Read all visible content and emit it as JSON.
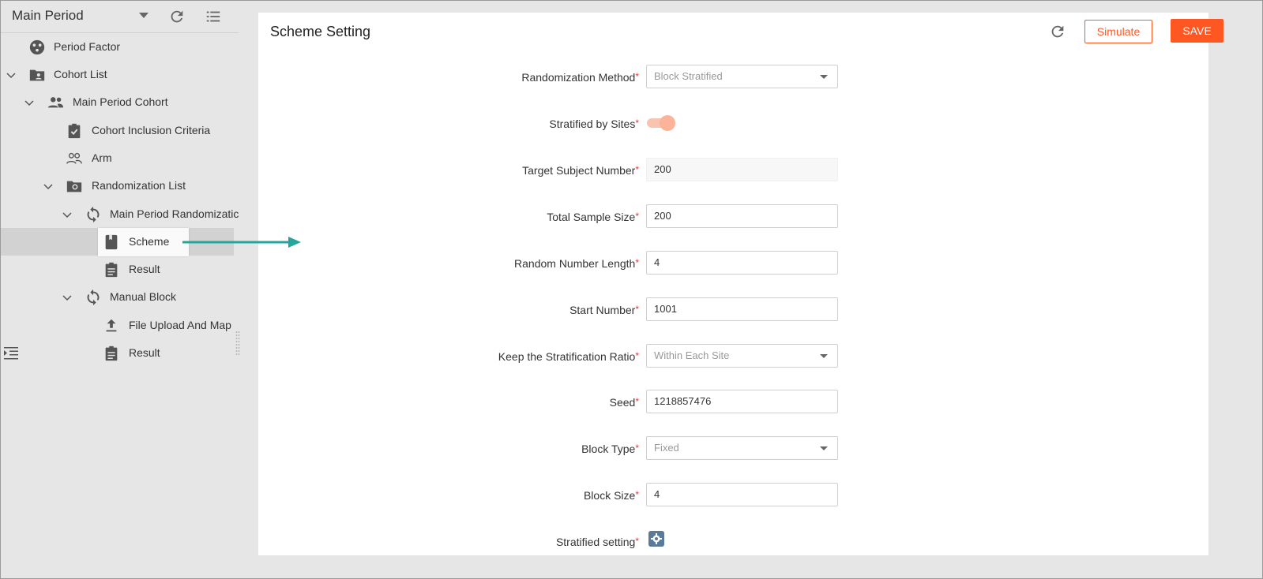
{
  "sidebar": {
    "period": "Main Period",
    "items": [
      {
        "label": "Period Factor",
        "icon": "period-factor-icon"
      },
      {
        "label": "Cohort List",
        "icon": "folder-account-icon"
      },
      {
        "label": "Main Period Cohort",
        "icon": "people-icon"
      },
      {
        "label": "Cohort Inclusion Criteria",
        "icon": "clipboard-check-icon"
      },
      {
        "label": "Arm",
        "icon": "people-outline-icon"
      },
      {
        "label": "Randomization List",
        "icon": "folder-sync-icon"
      },
      {
        "label": "Main Period Randomizatic",
        "icon": "sync-icon"
      },
      {
        "label": "Scheme",
        "icon": "book-icon"
      },
      {
        "label": "Result",
        "icon": "clipboard-text-icon"
      },
      {
        "label": "Manual Block",
        "icon": "sync-icon"
      },
      {
        "label": "File Upload And Map",
        "icon": "upload-icon"
      },
      {
        "label": "Result",
        "icon": "clipboard-text-icon"
      }
    ]
  },
  "main": {
    "title": "Scheme Setting",
    "simulate_label": "Simulate",
    "save_label": "SAVE",
    "accent": "#ff5722",
    "fields": {
      "randomization_method": {
        "label": "Randomization Method",
        "value": "Block Stratified"
      },
      "stratified_by_sites": {
        "label": "Stratified by Sites",
        "value": "on"
      },
      "target_subject_number": {
        "label": "Target Subject Number",
        "value": "200"
      },
      "total_sample_size": {
        "label": "Total Sample Size",
        "value": "200"
      },
      "random_number_length": {
        "label": "Random Number Length",
        "value": "4"
      },
      "start_number": {
        "label": "Start Number",
        "value": "1001"
      },
      "keep_stratification_ratio": {
        "label": "Keep the Stratification Ratio",
        "value": "Within Each Site"
      },
      "seed": {
        "label": "Seed",
        "value": "1218857476"
      },
      "block_type": {
        "label": "Block Type",
        "value": "Fixed"
      },
      "block_size": {
        "label": "Block Size",
        "value": "4"
      },
      "stratified_setting": {
        "label": "Stratified setting"
      }
    }
  }
}
